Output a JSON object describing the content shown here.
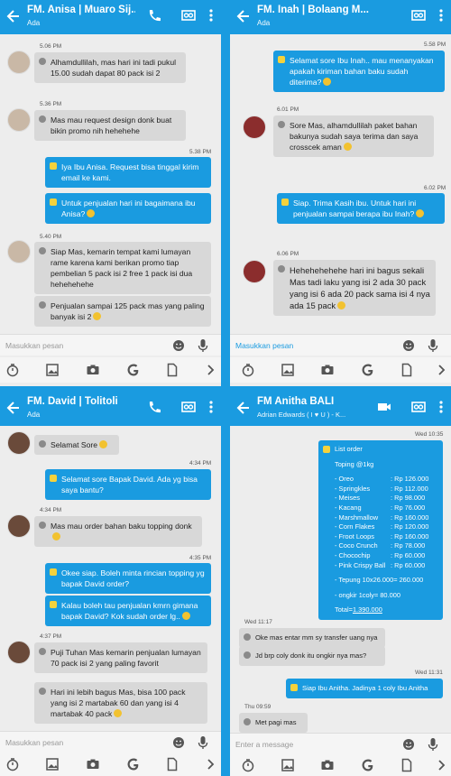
{
  "p1": {
    "title": "FM. Anisa | Muaro Sij...",
    "sub": "Ada",
    "t1": "5.06 PM",
    "m1": "Alhamdullilah, mas hari ini tadi pukul 15.00 sudah dapat 80 pack isi 2",
    "t2": "5.36 PM",
    "m2": "Mas mau request design donk buat bikin promo nih hehehehe",
    "t3": "5.38 PM",
    "m3": "Iya Ibu Anisa. Request bisa tinggal kirim email ke kami.",
    "m4": "Untuk penjualan hari ini bagaimana ibu Anisa?",
    "t4": "5.40 PM",
    "m5": "Siap Mas, kemarin tempat kami lumayan rame karena kami berikan promo tiap pembelian 5 pack isi 2 free 1 pack isi dua hehehehehe",
    "m6": "Penjualan sampai 125 pack mas yang paling banyak isi 2",
    "placeholder": "Masukkan pesan"
  },
  "p2": {
    "title": "FM. Inah | Bolaang M...",
    "sub": "Ada",
    "t1": "5.58 PM",
    "m1": "Selamat sore Ibu Inah.. mau menanyakan apakah kiriman bahan baku sudah diterima?",
    "t2": "6.01 PM",
    "m2": "Sore Mas, alhamdullilah paket bahan bakunya sudah saya terima dan saya crosscek aman",
    "t3": "6.02 PM",
    "m3": "Siap. Trima Kasih ibu. Untuk hari ini penjualan sampai berapa ibu Inah?",
    "t4": "6.06 PM",
    "m4": "Hehehehehehe hari ini bagus sekali Mas tadi laku yang isi 2 ada 30 pack yang isi 6 ada 20 pack sama isi 4 nya ada 15 pack",
    "placeholder": "Masukkan pesan"
  },
  "p3": {
    "title": "FM. David | Tolitoli",
    "sub": "Ada",
    "m1": "Selamat Sore",
    "t1": "4:34 PM",
    "m2": "Selamat sore Bapak David. Ada yg bisa saya bantu?",
    "t2": "4:34 PM",
    "m3": "Mas mau order bahan baku topping donk",
    "t3": "4:35 PM",
    "m4": "Okee siap. Boleh minta rincian topping yg bapak David order?",
    "m5": "Kalau boleh tau penjualan kmrn gimana bapak David? Kok sudah order lg..",
    "t4": "4:37 PM",
    "m6": "Puji Tuhan Mas kemarin penjualan lumayan 70 pack isi 2 yang paling favorit",
    "m7": "Hari ini lebih bagus Mas, bisa 100 pack yang isi 2 martabak 60 dan yang isi 4 martabak 40 pack",
    "placeholder": "Masukkan pesan"
  },
  "p4": {
    "title": "FM Anitha BALI",
    "sub": "Adrian Edwards ( I ♥ U ) - K...",
    "t1": "Wed 10:35",
    "order_title": "List order",
    "order_sub": "Toping @1kg",
    "items": [
      {
        "name": "- Oreo",
        "price": ": Rp 126.000"
      },
      {
        "name": "- Springkles",
        "price": ": Rp 112.000"
      },
      {
        "name": "- Meises",
        "price": ": Rp 98.000"
      },
      {
        "name": "- Kacang",
        "price": ": Rp 76.000"
      },
      {
        "name": "- Marshmallow",
        "price": ": Rp 160.000"
      },
      {
        "name": "- Corn Flakes",
        "price": ": Rp 120.000"
      },
      {
        "name": "- Froot Loops",
        "price": ": Rp 160.000"
      },
      {
        "name": "- Coco Crunch",
        "price": ": Rp 78.000"
      },
      {
        "name": "- Chocochip",
        "price": ": Rp 60.000"
      },
      {
        "name": "- Pink Crispy Ball",
        "price": ": Rp 60.000"
      }
    ],
    "tepung": "- Tepung 10x26.000= 260.000",
    "ongkir": "- ongkir 1coly= 80.000",
    "total_label": "Total=",
    "total_value": "1.390.000",
    "t2": "Wed 11:17",
    "m2": "Oke mas entar mm sy transfer uang nya",
    "m3": "Jd brp coly donk itu ongkir nya mas?",
    "t3": "Wed 11:31",
    "m4": "Siap Ibu Anitha. Jadinya 1 coly Ibu Anitha",
    "t4": "Thu 09:59",
    "m5": "Met pagi mas",
    "placeholder": "Enter a message"
  }
}
